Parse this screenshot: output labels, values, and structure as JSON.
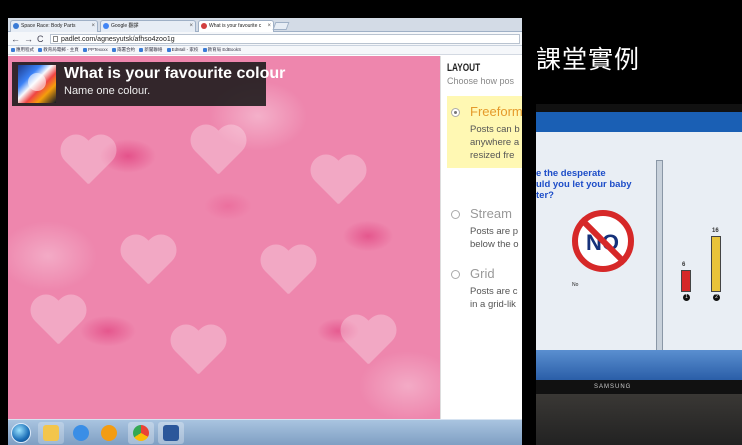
{
  "browser": {
    "tabs": [
      {
        "label": "Space Race: Body Parts",
        "color": "#3a7bd5"
      },
      {
        "label": "Google 翻譯",
        "color": "#4285f4"
      },
      {
        "label": "What is your favourite c",
        "color": "#d23f3f"
      }
    ],
    "url": "padlet.com/agnesyutsk/afhso4zoo1g",
    "bookmarks": [
      "應用程式",
      "教育局電郵 - 主頁",
      "PPTexxxx",
      "兩署合約",
      "新聞聯絡",
      "EdMall - 家校",
      "教育局 EdBookS"
    ]
  },
  "wall": {
    "title": "What is your favourite colour",
    "subtitle": "Name one colour."
  },
  "layout_panel": {
    "heading": "LAYOUT",
    "hint": "Choose how pos",
    "options": [
      {
        "name": "Freeform",
        "desc": [
          "Posts can b",
          "anywhere a",
          "resized fre"
        ],
        "selected": true
      },
      {
        "name": "Stream",
        "desc": [
          "Posts are p",
          "below the o"
        ],
        "selected": false
      },
      {
        "name": "Grid",
        "desc": [
          "Posts are c",
          "in a grid-lik"
        ],
        "selected": false
      }
    ]
  },
  "taskbar_apps": [
    "windows-explorer",
    "ie-browser",
    "media-player",
    "chrome",
    "word"
  ],
  "slide": {
    "title": "課堂實例"
  },
  "photo": {
    "doc_text": "e the desperate\nuld you let your baby\nter?",
    "no_label": "NO",
    "tiny_label": "No",
    "chart_values": [
      "6",
      "16"
    ],
    "chart_markers": [
      "1",
      "2"
    ],
    "brand": "SAMSUNG"
  }
}
